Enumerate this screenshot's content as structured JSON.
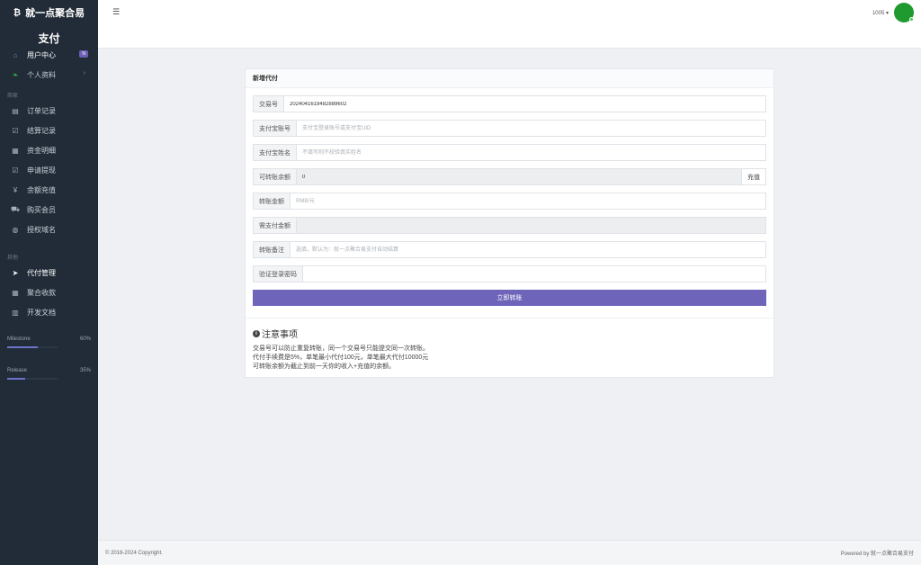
{
  "sidebar": {
    "brand": "就一点聚合易",
    "brand_icon": "bitcoin-icon",
    "site_sub": "支付",
    "items_top": [
      {
        "label": "用户中心",
        "icon": "home-icon",
        "badge": "N",
        "active": true
      },
      {
        "label": "个人资料",
        "icon": "leaf-icon",
        "chevron": "›"
      }
    ],
    "section1": "商家",
    "items_mid": [
      {
        "label": "订单记录",
        "icon": "list-icon"
      },
      {
        "label": "结算记录",
        "icon": "check-icon"
      },
      {
        "label": "资金明细",
        "icon": "calendar-icon"
      },
      {
        "label": "申请提现",
        "icon": "withdraw-icon"
      },
      {
        "label": "余额充值",
        "icon": "yen-icon"
      },
      {
        "label": "购买会员",
        "icon": "cart-icon"
      },
      {
        "label": "授权域名",
        "icon": "globe-icon"
      }
    ],
    "section2": "其他",
    "items_bottom": [
      {
        "label": "代付管理",
        "icon": "send-icon",
        "active": true
      },
      {
        "label": "聚合收款",
        "icon": "grid-icon"
      },
      {
        "label": "开发文档",
        "icon": "book-icon"
      }
    ],
    "progress": [
      {
        "label": "Milestone",
        "percent_text": "60%",
        "value": 0.6
      },
      {
        "label": "Release",
        "percent_text": "35%",
        "value": 0.35
      }
    ]
  },
  "topbar": {
    "menu_icon": "menu-icon",
    "user_name": "1005",
    "caret": "▾"
  },
  "card": {
    "title": "新增代付",
    "fields": {
      "trade_no": {
        "label": "交易号",
        "value": "2024041619482889602"
      },
      "alipay_account": {
        "label": "支付宝账号",
        "placeholder": "支付宝登录账号或支付宝UID"
      },
      "alipay_name": {
        "label": "支付宝姓名",
        "placeholder": "不填写则不校验真实姓名"
      },
      "balance": {
        "label": "可转账余额",
        "value": "0",
        "button": "充值"
      },
      "amount": {
        "label": "转账金额",
        "placeholder": "RMB/元"
      },
      "pay_amount": {
        "label": "需支付金额",
        "value": ""
      },
      "remark": {
        "label": "转账备注",
        "placeholder": "选填，默认为：就一点聚合易支付自动结算"
      },
      "password": {
        "label": "验证登录密码",
        "value": ""
      }
    },
    "submit": "立即转账"
  },
  "notice": {
    "title": "注意事项",
    "lines": [
      "交易号可以防止重复转账，同一个交易号只能提交同一次转账。",
      "代付手续费是5%，单笔最小代付100元，单笔最大代付10000元",
      "可转账余额为截止到前一天你的收入+充值的余额。"
    ]
  },
  "footer": {
    "left": "© 2016-2024 Copyright.",
    "right": "Powered by 就一点聚合易支付"
  }
}
